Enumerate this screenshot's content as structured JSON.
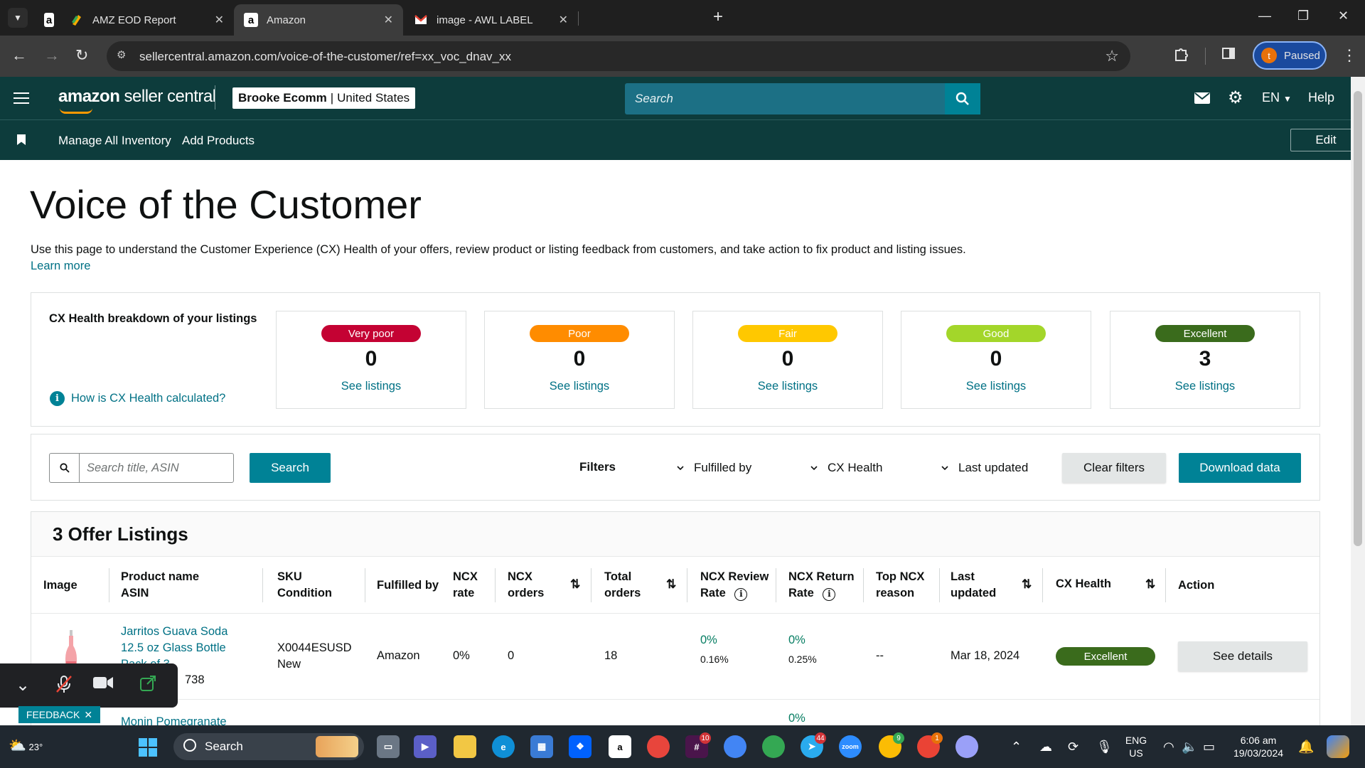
{
  "browser": {
    "tabs": [
      {
        "title": "",
        "favicon": "a"
      },
      {
        "title": "AMZ EOD Report",
        "favicon": "sheets-icon"
      },
      {
        "title": "Amazon",
        "favicon": "a"
      },
      {
        "title": "image - AWL LABEL",
        "favicon": "gmail-icon"
      }
    ],
    "url": "sellercentral.amazon.com/voice-of-the-customer/ref=xx_voc_dnav_xx",
    "profile_initial": "t",
    "profile_status": "Paused"
  },
  "header": {
    "logo_amazon": "amazon",
    "logo_rest": "seller central",
    "account_name": "Brooke Ecomm",
    "account_sep": "|",
    "account_region": "United States",
    "search_placeholder": "Search",
    "language": "EN",
    "help": "Help"
  },
  "subnav": {
    "links": [
      "Manage All Inventory",
      "Add Products"
    ],
    "edit": "Edit"
  },
  "page": {
    "title": "Voice of the Customer",
    "description": "Use this page to understand the Customer Experience (CX) Health of your offers, review product or listing feedback from customers, and take action to fix product and listing issues.",
    "learn_more": "Learn more"
  },
  "cx_health": {
    "heading": "CX Health breakdown of your listings",
    "how_link": "How is CX Health calculated?",
    "buckets": [
      {
        "label": "Very poor",
        "count": "0",
        "link": "See listings",
        "color": "#c40233",
        "text_color": "#ffffff"
      },
      {
        "label": "Poor",
        "count": "0",
        "link": "See listings",
        "color": "#ff8c00",
        "text_color": "#ffffff"
      },
      {
        "label": "Fair",
        "count": "0",
        "link": "See listings",
        "color": "#ffc800",
        "text_color": "#ffffff"
      },
      {
        "label": "Good",
        "count": "0",
        "link": "See listings",
        "color": "#a3d62a",
        "text_color": "#ffffff"
      },
      {
        "label": "Excellent",
        "count": "3",
        "link": "See listings",
        "color": "#3a6b1c",
        "text_color": "#ffffff"
      }
    ]
  },
  "filters": {
    "search_placeholder": "Search title, ASIN",
    "search_button": "Search",
    "label": "Filters",
    "dropdowns": [
      "Fulfilled by",
      "CX Health",
      "Last updated"
    ],
    "clear": "Clear filters",
    "download": "Download data"
  },
  "table": {
    "title": "3 Offer Listings",
    "headers": {
      "image": "Image",
      "product_name": "Product name",
      "asin": "ASIN",
      "sku": "SKU",
      "condition": "Condition",
      "fulfilled_by": "Fulfilled by",
      "ncx_rate_1": "NCX",
      "ncx_rate_2": "rate",
      "ncx_orders_1": "NCX",
      "ncx_orders_2": "orders",
      "total_orders_1": "Total",
      "total_orders_2": "orders",
      "ncx_review_1": "NCX Review",
      "ncx_review_2": "Rate",
      "ncx_return_1": "NCX Return",
      "ncx_return_2": "Rate",
      "top_ncx_1": "Top NCX",
      "top_ncx_2": "reason",
      "last_updated_1": "Last",
      "last_updated_2": "updated",
      "cx_health": "CX Health",
      "action": "Action"
    },
    "rows": [
      {
        "product_line1": "Jarritos Guava Soda",
        "product_line2": "12.5 oz Glass Bottle",
        "product_line3": "Pack of 3",
        "asin_tail": "738",
        "sku": "X0044ESUSD",
        "condition": "New",
        "fulfilled_by": "Amazon",
        "ncx_rate": "0%",
        "ncx_orders": "0",
        "total_orders": "18",
        "ncx_review_rate": "0%",
        "ncx_review_sub": "0.16%",
        "ncx_return_rate": "0%",
        "ncx_return_sub": "0.25%",
        "top_ncx_reason": "--",
        "last_updated": "Mar 18, 2024",
        "cx_health": "Excellent",
        "action": "See details"
      },
      {
        "product_line1": "Monin Pomegranate",
        "ncx_return_rate": "0%"
      }
    ]
  },
  "overlays": {
    "feedback": "FEEDBACK"
  },
  "taskbar": {
    "weather": "23°",
    "search": "Search",
    "lang_1": "ENG",
    "lang_2": "US",
    "time": "6:06 am",
    "date": "19/03/2024",
    "badges": [
      "10",
      "44",
      "9",
      "1"
    ]
  }
}
